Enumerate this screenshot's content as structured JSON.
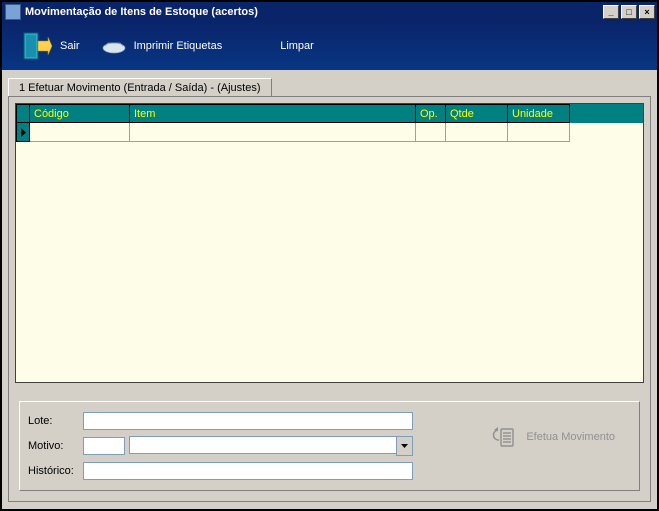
{
  "window": {
    "title": "Movimentação de Itens de Estoque (acertos)"
  },
  "toolbar": {
    "exit_label": "Sair",
    "print_label": "Imprimir Etiquetas",
    "clear_label": "Limpar"
  },
  "tabs": {
    "main_label": "1 Efetuar Movimento (Entrada / Saída) - (Ajustes)"
  },
  "grid": {
    "headers": {
      "codigo": "Código",
      "item": "Item",
      "op": "Op.",
      "qtde": "Qtde",
      "unidade": "Unidade"
    },
    "rows": [
      {
        "codigo": "",
        "item": "",
        "op": "",
        "qtde": "",
        "unidade": ""
      }
    ]
  },
  "form": {
    "lote_label": "Lote:",
    "motivo_label": "Motivo:",
    "historico_label": "Histórico:",
    "lote_value": "",
    "motivo_code": "",
    "motivo_value": "",
    "historico_value": ""
  },
  "action": {
    "label": "Efetua Movimento"
  }
}
